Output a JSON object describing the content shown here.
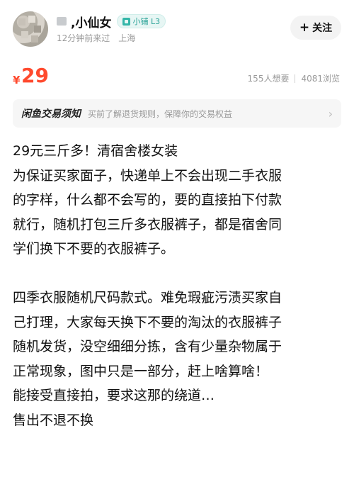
{
  "seller": {
    "name": ",小仙女",
    "level_badge": "小铺 L3",
    "last_seen": "12分钟前来过",
    "location": "上海",
    "follow_label": "关注"
  },
  "listing": {
    "currency": "¥",
    "price": "29",
    "wants": "155人想要",
    "views": "4081浏览"
  },
  "notice": {
    "title": "闲鱼交易须知",
    "text": "买前了解退货规则，保障你的交易权益"
  },
  "description": {
    "para1": [
      "29元三斤多！清宿舍楼女装",
      "为保证买家面子，快递单上不会出现二手衣服",
      "的字样，什么都不会写的，要的直接拍下付款",
      "就行，随机打包三斤多衣服裤子，都是宿舍同",
      "学们换下不要的衣服裤子。"
    ],
    "para2": [
      "四季衣服随机尺码款式。难免瑕疵污渍买家自",
      "己打理，大家每天换下不要的淘汰的衣服裤子",
      "随机发货，没空细细分拣，含有少量杂物属于",
      "正常现象，图中只是一部分，赶上啥算啥！",
      "能接受直接拍，要求这那的绕道…",
      "售出不退不换"
    ]
  },
  "icons": {
    "avatar": "blurred-avatar",
    "badge": "shop-badge-icon",
    "follow": "plus-icon",
    "notice_arrow": "chevron-right-icon"
  },
  "colors": {
    "price": "#ff4a2e",
    "badge": "#2aa297"
  }
}
